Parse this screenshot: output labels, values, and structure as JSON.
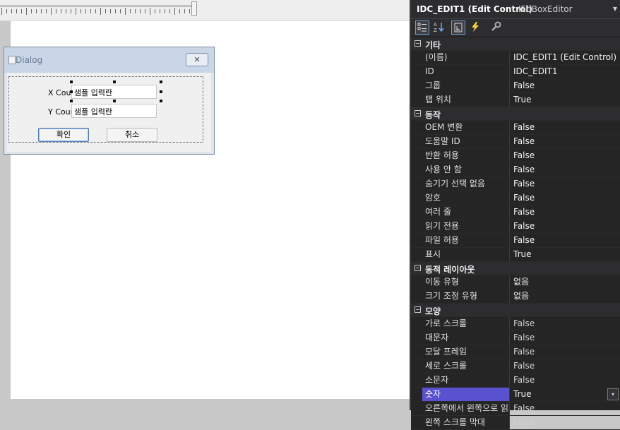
{
  "designer": {
    "dialog": {
      "title": "Dialog",
      "close_glyph": "✕",
      "x_label": "X Count",
      "y_label": "Y Count",
      "x_edit_value": "샘플 입력란",
      "y_edit_value": "샘플 입력란",
      "ok_label": "확인",
      "cancel_label": "취소"
    }
  },
  "properties": {
    "header": {
      "control_name": "IDC_EDIT1 (Edit Control)",
      "editor_type": "IEdBoxEditor"
    },
    "toolbar": {
      "categorized_icon": "categorized-icon",
      "alphabetical_icon": "alphabetical-icon",
      "properties_icon": "properties-icon",
      "events_icon": "events-icon",
      "property_pages_icon": "wrench-icon"
    },
    "categories": [
      {
        "name": "기타",
        "rows": [
          {
            "name": "(이름)",
            "value": "IDC_EDIT1 (Edit Control)"
          },
          {
            "name": "ID",
            "value": "IDC_EDIT1"
          },
          {
            "name": "그룹",
            "value": "False"
          },
          {
            "name": "탭 위치",
            "value": "True"
          }
        ]
      },
      {
        "name": "동작",
        "rows": [
          {
            "name": "OEM 변환",
            "value": "False"
          },
          {
            "name": "도움말 ID",
            "value": "False"
          },
          {
            "name": "반환 허용",
            "value": "False"
          },
          {
            "name": "사용 안 함",
            "value": "False"
          },
          {
            "name": "숨기기 선택 없음",
            "value": "False"
          },
          {
            "name": "암호",
            "value": "False"
          },
          {
            "name": "여러 줄",
            "value": "False"
          },
          {
            "name": "읽기 전용",
            "value": "False"
          },
          {
            "name": "파일 허용",
            "value": "False"
          },
          {
            "name": "표시",
            "value": "True"
          }
        ]
      },
      {
        "name": "동적 레이아웃",
        "rows": [
          {
            "name": "이동 유형",
            "value": "없음"
          },
          {
            "name": "크기 조정 유형",
            "value": "없음"
          }
        ]
      },
      {
        "name": "모양",
        "rows": [
          {
            "name": "가로 스크롤",
            "value": "False"
          },
          {
            "name": "대문자",
            "value": "False"
          },
          {
            "name": "모달 프레임",
            "value": "False"
          },
          {
            "name": "세로 스크롤",
            "value": "False"
          },
          {
            "name": "소문자",
            "value": "False"
          },
          {
            "name": "숫자",
            "value": "True",
            "selected": true
          },
          {
            "name": "오른쪽에서 왼쪽으로 읽기",
            "value": "False"
          },
          {
            "name": "왼쪽 스크롤 막대",
            "value": "False"
          }
        ]
      }
    ],
    "selected_color": "#5a51d1"
  }
}
